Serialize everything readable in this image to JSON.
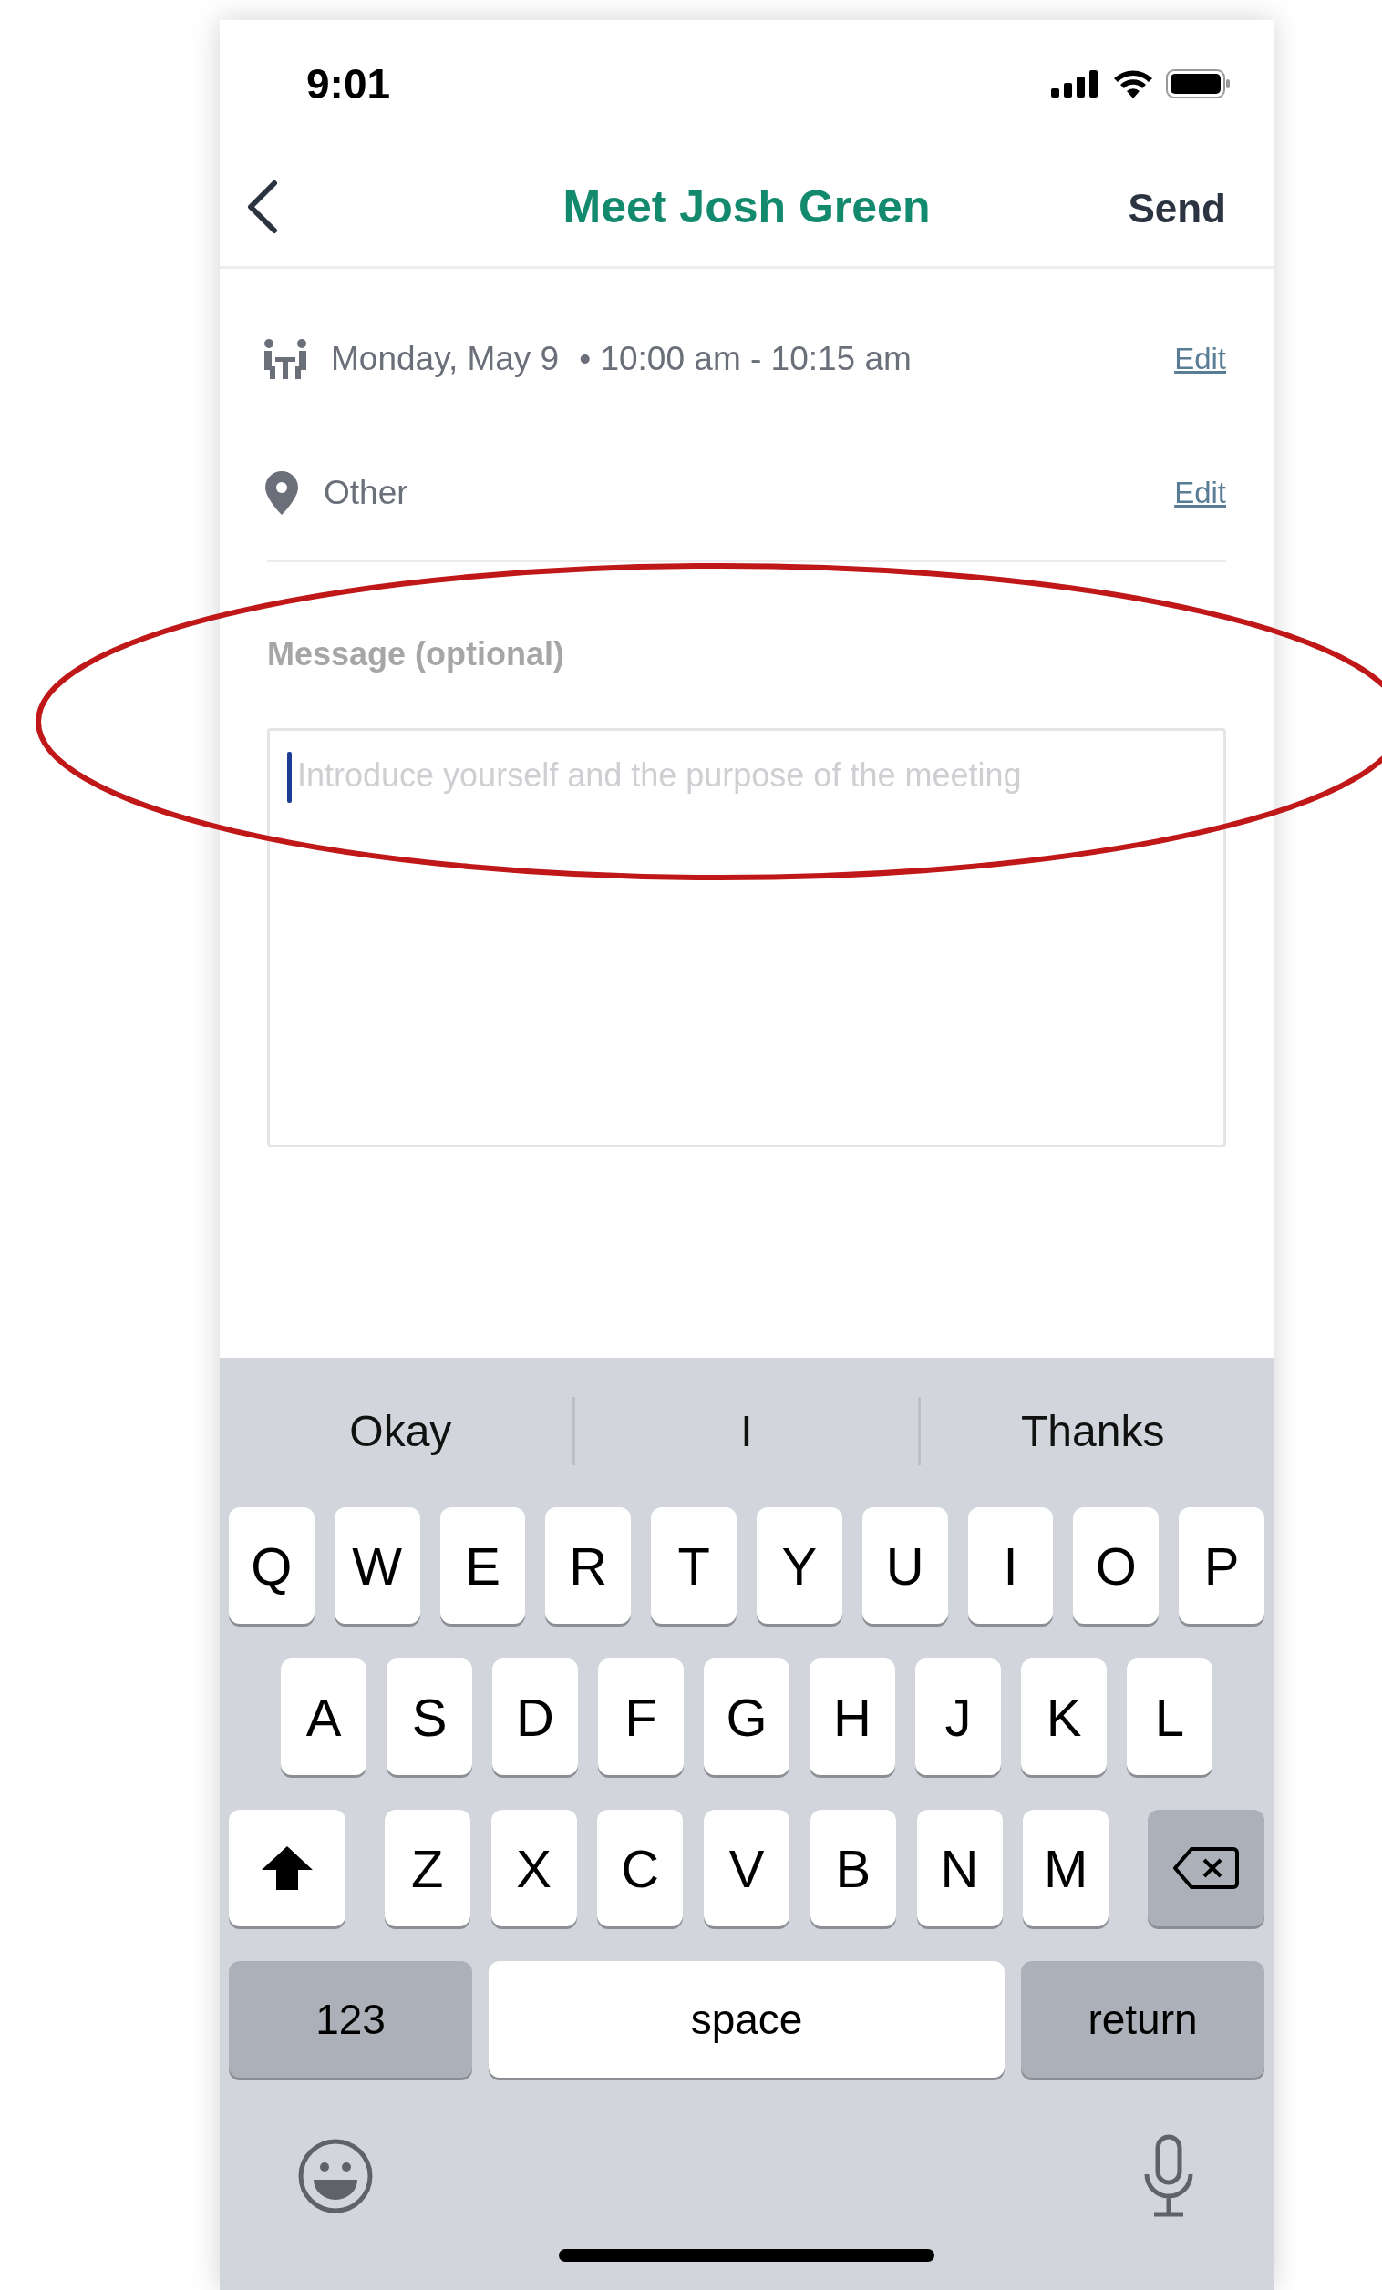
{
  "status_bar": {
    "time": "9:01"
  },
  "header": {
    "title": "Meet Josh Green",
    "action": "Send"
  },
  "details": [
    {
      "kind": "datetime",
      "date": "Monday, May 9",
      "time": "• 10:00 am - 10:15 am",
      "edit": "Edit"
    },
    {
      "kind": "location",
      "text": "Other",
      "edit": "Edit"
    }
  ],
  "message": {
    "label": "Message (optional)",
    "placeholder": "Introduce yourself and the purpose of the meeting"
  },
  "keyboard": {
    "suggestions": [
      "Okay",
      "I",
      "Thanks"
    ],
    "letter_rows": [
      [
        "Q",
        "W",
        "E",
        "R",
        "T",
        "Y",
        "U",
        "I",
        "O",
        "P"
      ],
      [
        "A",
        "S",
        "D",
        "F",
        "G",
        "H",
        "J",
        "K",
        "L"
      ],
      [
        "Z",
        "X",
        "C",
        "V",
        "B",
        "N",
        "M"
      ]
    ],
    "numbers_key": "123",
    "space_key": "space",
    "return_key": "return"
  }
}
